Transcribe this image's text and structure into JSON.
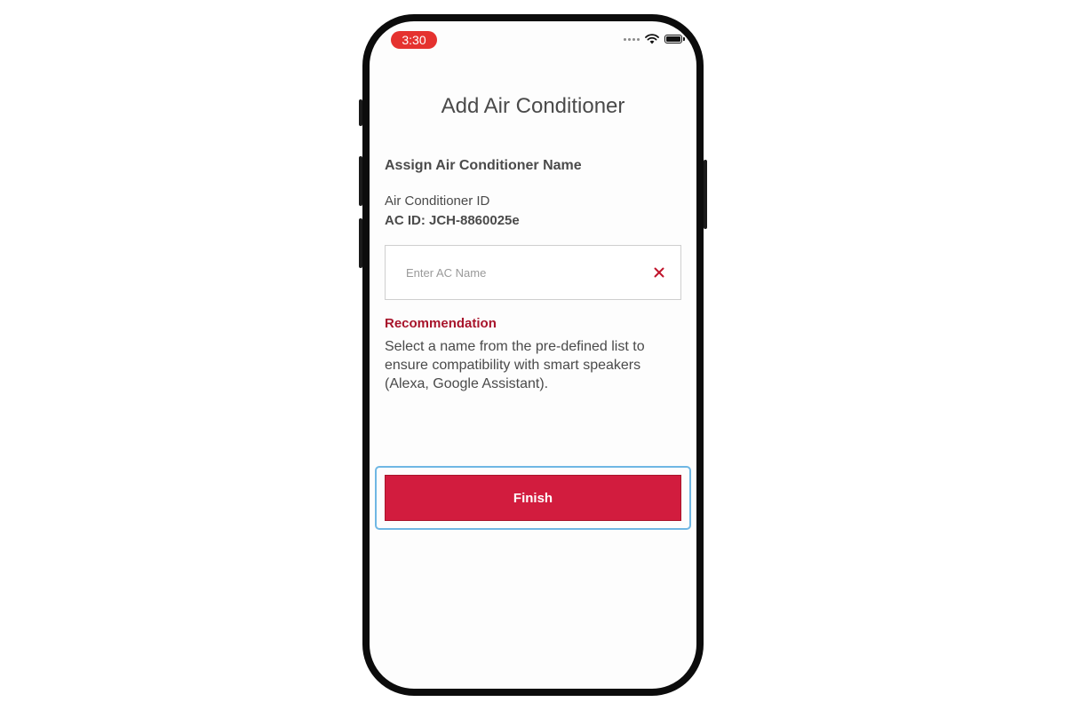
{
  "status_bar": {
    "time": "3:30",
    "icons": [
      "signal-dots-icon",
      "wifi-icon",
      "battery-icon"
    ],
    "time_pill_color": "#e5322f"
  },
  "screen": {
    "title": "Add Air Conditioner",
    "section_heading": "Assign Air Conditioner Name",
    "id_label": "Air Conditioner ID",
    "id_value": "AC ID: JCH-8860025e",
    "name_input": {
      "value": "",
      "placeholder": "Enter AC Name",
      "clear_icon": "close-icon"
    },
    "recommendation": {
      "heading": "Recommendation",
      "body": "Select a name from the pre-defined list to ensure compatibility with smart speakers (Alexa, Google Assistant)."
    },
    "finish_label": "Finish"
  },
  "colors": {
    "accent": "#d21c3e",
    "recommendation_heading": "#a8142b",
    "focus_ring": "#6fb7e4",
    "text": "#4a4a4a"
  }
}
